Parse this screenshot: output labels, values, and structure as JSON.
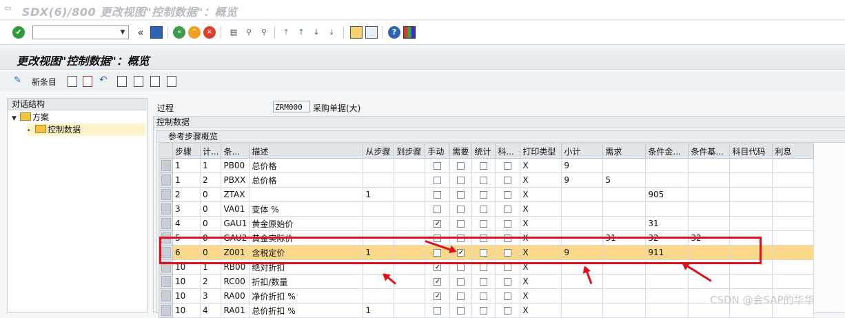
{
  "window": {
    "title": "SDX(6)/800 更改视图\"控制数据\"：概览"
  },
  "page_header": {
    "title": "更改视图\"控制数据\"：概览"
  },
  "app_toolbar": {
    "new_entries_label": "新条目"
  },
  "dialog_structure": {
    "header": "对话结构",
    "items": [
      {
        "label": "方案",
        "level": 0
      },
      {
        "label": "控制数据",
        "level": 1
      }
    ]
  },
  "procedure": {
    "label": "过程",
    "value": "ZRM000",
    "description": "采购单据(大)"
  },
  "control_group": {
    "title": "控制数据"
  },
  "steps_group": {
    "title": "参考步骤概览"
  },
  "table": {
    "columns": [
      "步骤",
      "计...",
      "条...",
      "描述",
      "从步骤",
      "到步骤",
      "手动",
      "需要",
      "统计",
      "科...",
      "打印类型",
      "小计",
      "需求",
      "条件金...",
      "条件基...",
      "科目代码",
      "利息"
    ],
    "rows": [
      {
        "step": "1",
        "counter": "1",
        "ctype": "PB00",
        "desc": "总价格",
        "from": "",
        "to": "",
        "manual": false,
        "required": false,
        "stat": false,
        "acct": false,
        "print": "X",
        "subtotal": "9",
        "req": "",
        "altcalc": "",
        "altbase": "",
        "acctkey": "",
        "accrual": ""
      },
      {
        "step": "1",
        "counter": "2",
        "ctype": "PBXX",
        "desc": "总价格",
        "from": "",
        "to": "",
        "manual": false,
        "required": false,
        "stat": false,
        "acct": false,
        "print": "X",
        "subtotal": "9",
        "req": "5",
        "altcalc": "",
        "altbase": "",
        "acctkey": "",
        "accrual": ""
      },
      {
        "step": "2",
        "counter": "0",
        "ctype": "ZTAX",
        "desc": "",
        "from": "1",
        "to": "",
        "manual": false,
        "required": false,
        "stat": false,
        "acct": false,
        "print": "X",
        "subtotal": "",
        "req": "",
        "altcalc": "905",
        "altbase": "",
        "acctkey": "",
        "accrual": ""
      },
      {
        "step": "3",
        "counter": "0",
        "ctype": "VA01",
        "desc": "变体 %",
        "from": "",
        "to": "",
        "manual": false,
        "required": false,
        "stat": false,
        "acct": false,
        "print": "X",
        "subtotal": "",
        "req": "",
        "altcalc": "",
        "altbase": "",
        "acctkey": "",
        "accrual": ""
      },
      {
        "step": "4",
        "counter": "0",
        "ctype": "GAU1",
        "desc": "黄金原始价",
        "from": "",
        "to": "",
        "manual": true,
        "required": false,
        "stat": false,
        "acct": false,
        "print": "X",
        "subtotal": "",
        "req": "",
        "altcalc": "31",
        "altbase": "",
        "acctkey": "",
        "accrual": ""
      },
      {
        "step": "5",
        "counter": "0",
        "ctype": "GAU2",
        "desc": "黄金实际价",
        "from": "",
        "to": "",
        "manual": false,
        "required": false,
        "stat": false,
        "acct": false,
        "print": "X",
        "subtotal": "",
        "req": "31",
        "altcalc": "32",
        "altbase": "32",
        "acctkey": "",
        "accrual": ""
      },
      {
        "step": "6",
        "counter": "0",
        "ctype": "Z001",
        "desc": "含税定价",
        "from": "1",
        "to": "",
        "manual": false,
        "required": true,
        "stat": false,
        "acct": false,
        "print": "X",
        "subtotal": "9",
        "req": "",
        "altcalc": "911",
        "altbase": "",
        "acctkey": "",
        "accrual": "",
        "highlighted": true
      },
      {
        "step": "10",
        "counter": "1",
        "ctype": "RB00",
        "desc": "绝对折扣",
        "from": "",
        "to": "",
        "manual": true,
        "required": false,
        "stat": false,
        "acct": false,
        "print": "X",
        "subtotal": "",
        "req": "",
        "altcalc": "",
        "altbase": "",
        "acctkey": "",
        "accrual": ""
      },
      {
        "step": "10",
        "counter": "2",
        "ctype": "RC00",
        "desc": "折扣/数量",
        "from": "",
        "to": "",
        "manual": true,
        "required": false,
        "stat": false,
        "acct": false,
        "print": "X",
        "subtotal": "",
        "req": "",
        "altcalc": "",
        "altbase": "",
        "acctkey": "",
        "accrual": ""
      },
      {
        "step": "10",
        "counter": "3",
        "ctype": "RA00",
        "desc": "净价折扣 %",
        "from": "",
        "to": "",
        "manual": true,
        "required": false,
        "stat": false,
        "acct": false,
        "print": "X",
        "subtotal": "",
        "req": "",
        "altcalc": "",
        "altbase": "",
        "acctkey": "",
        "accrual": ""
      },
      {
        "step": "10",
        "counter": "4",
        "ctype": "RA01",
        "desc": "总价折扣 %",
        "from": "1",
        "to": "",
        "manual": false,
        "required": false,
        "stat": false,
        "acct": false,
        "print": "X",
        "subtotal": "",
        "req": "",
        "altcalc": "",
        "altbase": "",
        "acctkey": "",
        "accrual": ""
      }
    ]
  },
  "watermark": "CSDN @会SAP的华华",
  "colors": {
    "highlight_row": "#fbd989",
    "annotation_red": "#e0101a",
    "folder": "#f3c442"
  },
  "icons": {
    "toolbar1": [
      "enter-icon",
      "save-icon",
      "back-icon",
      "exit-icon",
      "cancel-icon",
      "print-icon",
      "find-icon",
      "find-next-icon",
      "first-page-icon",
      "previous-page-icon",
      "next-page-icon",
      "last-page-icon",
      "create-session-icon",
      "shortcut-icon",
      "help-icon",
      "layout-icon"
    ],
    "toolbar2": [
      "change-display-icon",
      "copy-icon",
      "delete-icon",
      "undo-icon",
      "select-all-icon",
      "select-block-icon",
      "deselect-all-icon",
      "other-view-icon"
    ]
  }
}
